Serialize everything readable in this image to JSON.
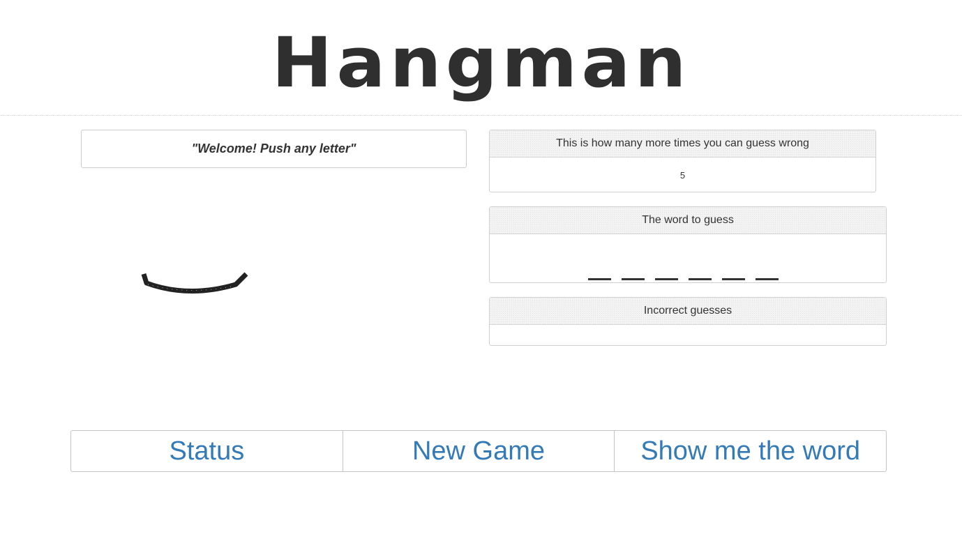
{
  "header": {
    "title": "Hangman"
  },
  "message": {
    "text": "\"Welcome! Push any letter\""
  },
  "drawing": {
    "icon": "hangman-base-arc-icon",
    "color": "#222222"
  },
  "remaining": {
    "label": "This is how many more times you can guess wrong",
    "value": "5"
  },
  "word": {
    "label": "The word to guess",
    "letters": [
      "",
      "",
      "",
      "",
      "",
      ""
    ]
  },
  "incorrect": {
    "label": "Incorrect guesses",
    "value": ""
  },
  "buttons": {
    "status": "Status",
    "new_game": "New Game",
    "show_word": "Show me the word"
  },
  "colors": {
    "link": "#337ab7",
    "text": "#333333",
    "title": "#2f2f2f"
  }
}
